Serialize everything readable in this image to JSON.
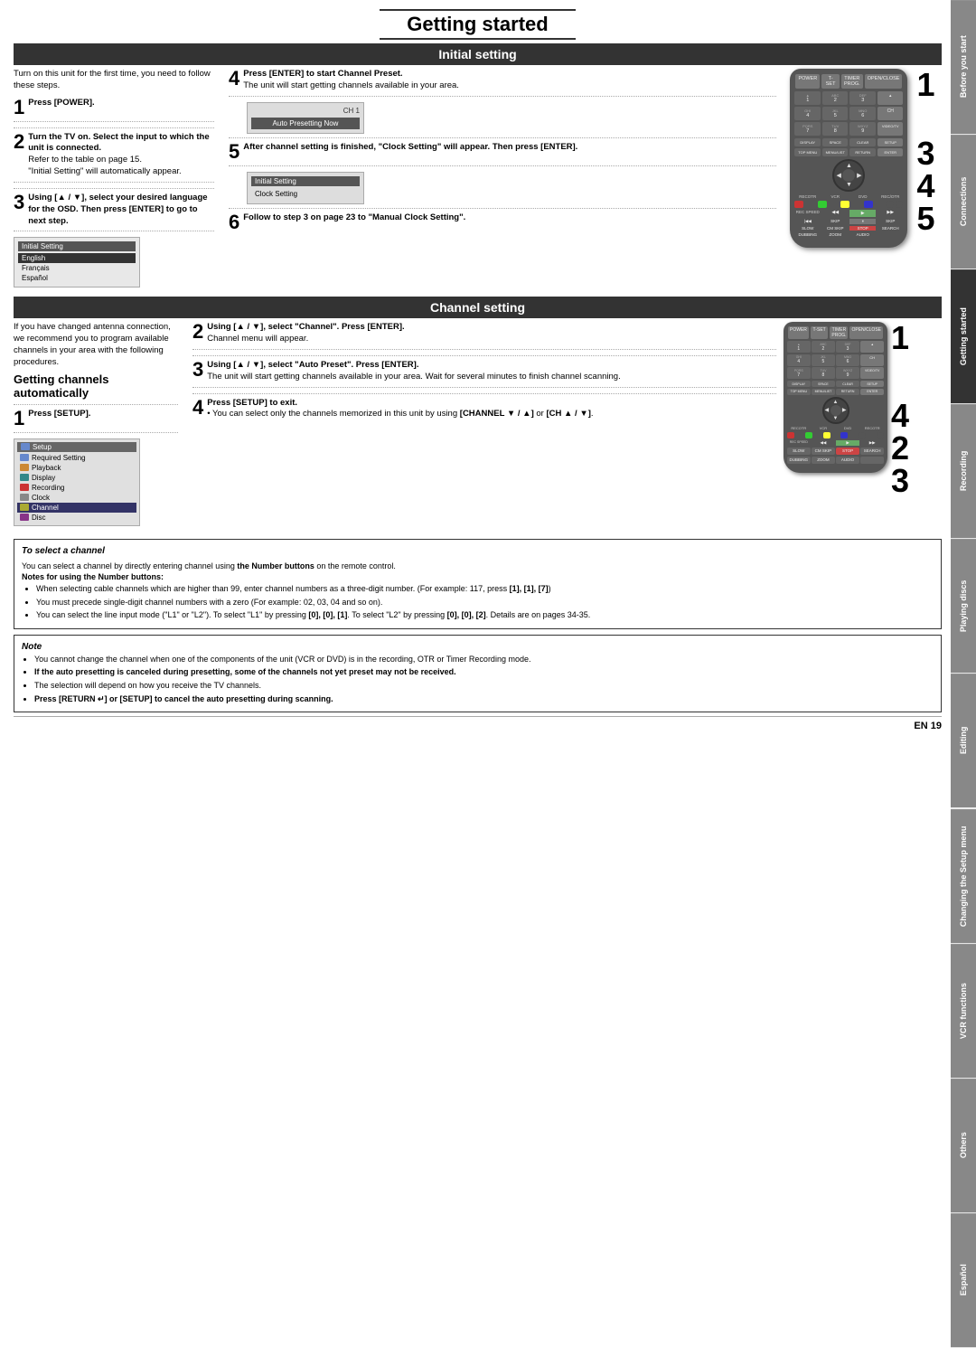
{
  "page": {
    "title": "Getting started",
    "page_number": "EN  19"
  },
  "tabs": {
    "items": [
      {
        "label": "Before you start"
      },
      {
        "label": "Connections"
      },
      {
        "label": "Getting started",
        "active": true
      },
      {
        "label": "Recording"
      },
      {
        "label": "Playing discs"
      },
      {
        "label": "Editing"
      },
      {
        "label": "Changing the Setup menu"
      },
      {
        "label": "VCR functions"
      },
      {
        "label": "Others"
      },
      {
        "label": "Español"
      }
    ]
  },
  "initial_setting": {
    "header": "Initial setting",
    "intro": "Turn on this unit for the first time, you need to follow these steps.",
    "steps": [
      {
        "num": "1",
        "instruction": "Press [POWER]."
      },
      {
        "num": "2",
        "instruction": "Turn the TV on. Select the input to which the unit is connected.",
        "detail": "Refer to the table on page 15.",
        "note": "\"Initial Setting\" will automatically appear."
      },
      {
        "num": "3",
        "instruction": "Using [▲ / ▼], select your desired language for the OSD. Then press [ENTER] to go to next step."
      }
    ],
    "steps_middle": [
      {
        "num": "4",
        "instruction": "Press [ENTER] to start Channel Preset.",
        "detail": "The unit will start getting channels available in your area."
      },
      {
        "num": "5",
        "instruction": "After channel setting is finished, \"Clock Setting\" will appear. Then press [ENTER]."
      },
      {
        "num": "6",
        "instruction": "Follow to step 3 on page 23 to \"Manual Clock Setting\"."
      }
    ]
  },
  "channel_setting": {
    "header": "Channel setting",
    "getting_channels": {
      "title": "Getting channels automatically",
      "intro": "If you have changed antenna connection, we recommend you to program available channels in your area with the following procedures."
    },
    "steps_left": [
      {
        "num": "1",
        "instruction": "Press [SETUP]."
      }
    ],
    "steps_middle": [
      {
        "num": "2",
        "instruction": "Using [▲ / ▼], select \"Channel\". Press [ENTER].",
        "detail": "Channel menu will appear."
      },
      {
        "num": "3",
        "instruction": "Using [▲ / ▼], select \"Auto Preset\". Press [ENTER].",
        "detail": "The unit will start getting channels available in your area. Wait for several minutes to finish channel scanning."
      },
      {
        "num": "4",
        "instruction": "Press [SETUP] to exit.",
        "bullets": [
          "You can select only the channels memorized in this unit by using [CHANNEL ▼ / ▲] or [CH ▲ / ▼]."
        ]
      }
    ]
  },
  "to_select_channel": {
    "title": "To select a channel",
    "intro": "You can select a channel by directly entering channel using",
    "intro_bold": "the Number buttons",
    "intro_end": "on the remote control.",
    "notes_title": "Notes for using the Number buttons:",
    "notes": [
      "When selecting cable channels which are higher than 99, enter channel numbers as a three-digit number. (For example: 117, press [1], [1], [7])",
      "You must precede single-digit channel numbers with a zero (For example: 02, 03, 04 and so on).",
      "You can select the line input mode (\"L1\" or \"L2\"). To select \"L1\" by pressing [0], [0], [1]. To select \"L2\" by pressing [0], [0], [2]. Details are on pages 34-35."
    ]
  },
  "note_section": {
    "label": "Note",
    "bullets": [
      "You cannot change the channel when one of the components of the unit (VCR or DVD) is in the recording, OTR or Timer Recording mode.",
      "If the auto presetting is canceled during presetting, some of the channels not yet preset may not be received.",
      "The selection will depend on how you receive the TV channels.",
      "Press [RETURN ↵] or [SETUP] to cancel the auto presetting during scanning."
    ]
  },
  "screen_lang": {
    "title": "Initial Setting",
    "items": [
      "English",
      "Français",
      "Español"
    ]
  },
  "screen_ch1": {
    "title": "CH 1",
    "status": "Auto Presetting Now"
  },
  "screen_clock": {
    "title": "Initial Setting",
    "item": "Clock Setting"
  },
  "setup_menu": {
    "title": "Setup",
    "items": [
      {
        "icon": "blue",
        "label": "Required Setting"
      },
      {
        "icon": "orange",
        "label": "Playback"
      },
      {
        "icon": "teal",
        "label": "Display"
      },
      {
        "icon": "red",
        "label": "Recording"
      },
      {
        "icon": "gray",
        "label": "Clock"
      },
      {
        "icon": "yellow",
        "label": "Channel",
        "selected": true
      },
      {
        "icon": "purple",
        "label": "Disc"
      }
    ]
  },
  "remote_keys": {
    "top_row": [
      "POWER",
      "T-SET",
      "TIMER PROG.",
      "OPEN/CLOSE"
    ],
    "row1": [
      "▲",
      "ABC",
      "DEF",
      "▲"
    ],
    "row2_labels": [
      "GHI",
      "JKL",
      "MNO",
      "CH"
    ],
    "row2": [
      "4",
      "5",
      "6",
      "▲"
    ],
    "row3_labels": [
      "PQRS",
      "TUV",
      "WXYZ",
      "VIDEO/TV"
    ],
    "row3": [
      "7",
      "8",
      "9",
      ""
    ],
    "row4": [
      "DISPLAY",
      "SPACE",
      "CLEAR",
      "SETUP"
    ],
    "row5": [
      "TOP MENU",
      "MENU/LIST",
      "RETURN",
      "ENTER"
    ],
    "transport": [
      "◀◀",
      "▶▶",
      "▶",
      "⏹"
    ],
    "transport2": [
      "SLOW",
      "CM SKIP",
      "STOP",
      "SEARCH"
    ],
    "transport3": [
      "DUBBING",
      "ZOOM",
      "AUDIO",
      ""
    ]
  }
}
